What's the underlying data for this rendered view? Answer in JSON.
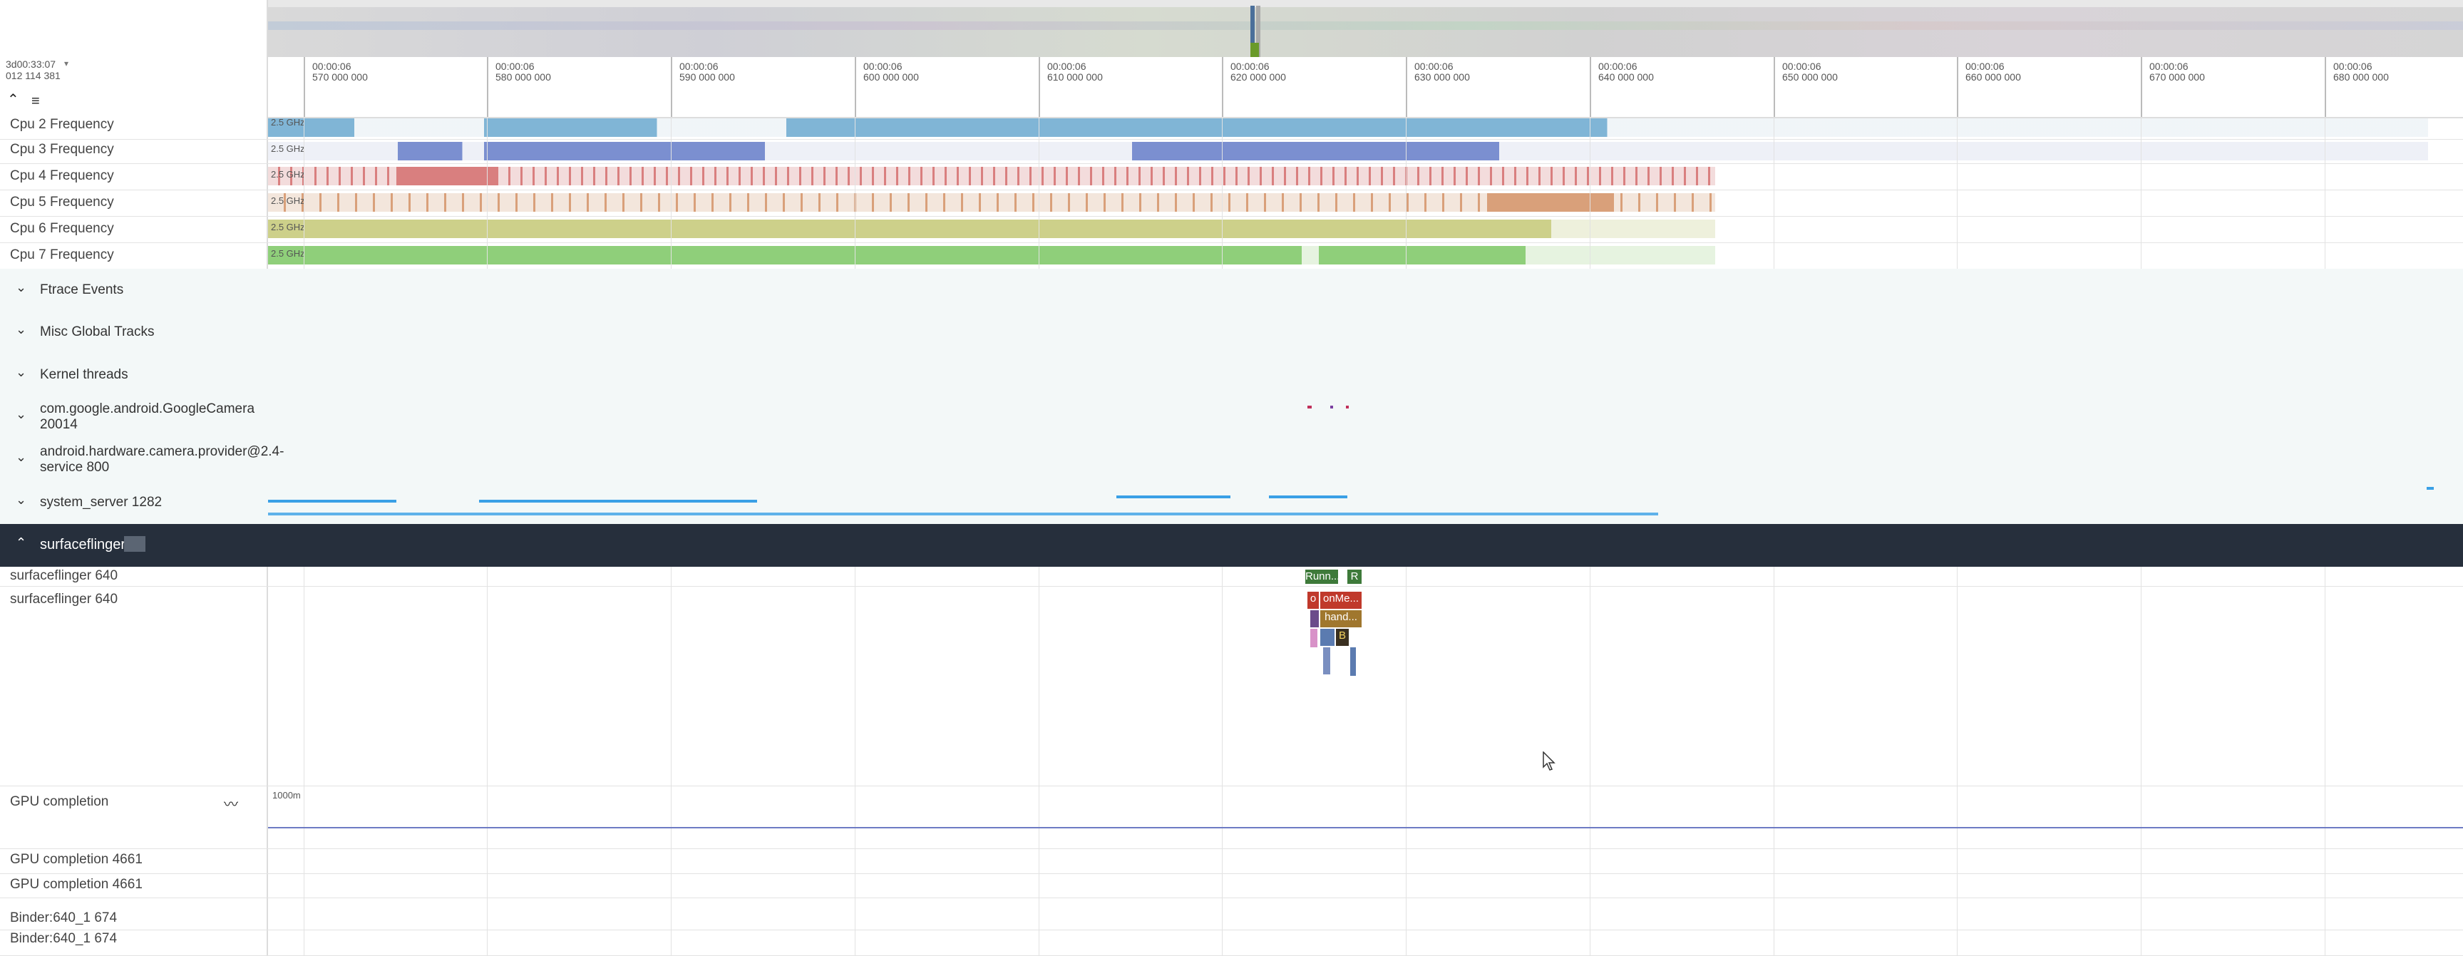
{
  "timeline": {
    "timestamp_line1": "3d00:33:07",
    "timestamp_line2": "012 114 381",
    "ticks": [
      {
        "t": "00:00:06",
        "ns": "570 000 000"
      },
      {
        "t": "00:00:06",
        "ns": "580 000 000"
      },
      {
        "t": "00:00:06",
        "ns": "590 000 000"
      },
      {
        "t": "00:00:06",
        "ns": "600 000 000"
      },
      {
        "t": "00:00:06",
        "ns": "610 000 000"
      },
      {
        "t": "00:00:06",
        "ns": "620 000 000"
      },
      {
        "t": "00:00:06",
        "ns": "630 000 000"
      },
      {
        "t": "00:00:06",
        "ns": "640 000 000"
      },
      {
        "t": "00:00:06",
        "ns": "650 000 000"
      },
      {
        "t": "00:00:06",
        "ns": "660 000 000"
      },
      {
        "t": "00:00:06",
        "ns": "670 000 000"
      },
      {
        "t": "00:00:06",
        "ns": "680 000 000"
      }
    ]
  },
  "cpu_tracks": [
    {
      "label": "Cpu 2 Frequency",
      "scale": "2.5 GHz",
      "color": "#6aa8cf"
    },
    {
      "label": "Cpu 3 Frequency",
      "scale": "2.5 GHz",
      "color": "#7b8fd0"
    },
    {
      "label": "Cpu 4 Frequency",
      "scale": "2.5 GHz",
      "color": "#d97f7f"
    },
    {
      "label": "Cpu 5 Frequency",
      "scale": "2.5 GHz",
      "color": "#d9a07a"
    },
    {
      "label": "Cpu 6 Frequency",
      "scale": "2.5 GHz",
      "color": "#cdd08a"
    },
    {
      "label": "Cpu 7 Frequency",
      "scale": "2.5 GHz",
      "color": "#8fcf7a"
    }
  ],
  "groups": [
    {
      "label": "Ftrace Events"
    },
    {
      "label": "Misc Global Tracks"
    },
    {
      "label": "Kernel threads"
    },
    {
      "label": "com.google.android.GoogleCamera 20014"
    },
    {
      "label": "android.hardware.camera.provider@2.4-service 800"
    },
    {
      "label": "system_server 1282"
    }
  ],
  "surfaceflinger": {
    "header": "surfaceflinger",
    "thread_rows": [
      "surfaceflinger 640",
      "surfaceflinger 640"
    ],
    "slices": {
      "running": "Runn...",
      "r": "R",
      "o": "o",
      "onme": "onMe...",
      "hand": "hand...",
      "b": "B"
    }
  },
  "bottom_tracks": [
    {
      "label": "GPU completion",
      "scale": "1000m"
    },
    {
      "label": "GPU completion 4661"
    },
    {
      "label": "GPU completion 4661"
    },
    {
      "label": "Binder:640_1 674"
    },
    {
      "label": "Binder:640_1 674"
    }
  ],
  "colors": {
    "header_bg": "#262f3c",
    "group_bg": "#f3f8f8",
    "running_green": "#3e7a3a",
    "slice_red": "#c0392b",
    "slice_brown": "#a0772e"
  }
}
